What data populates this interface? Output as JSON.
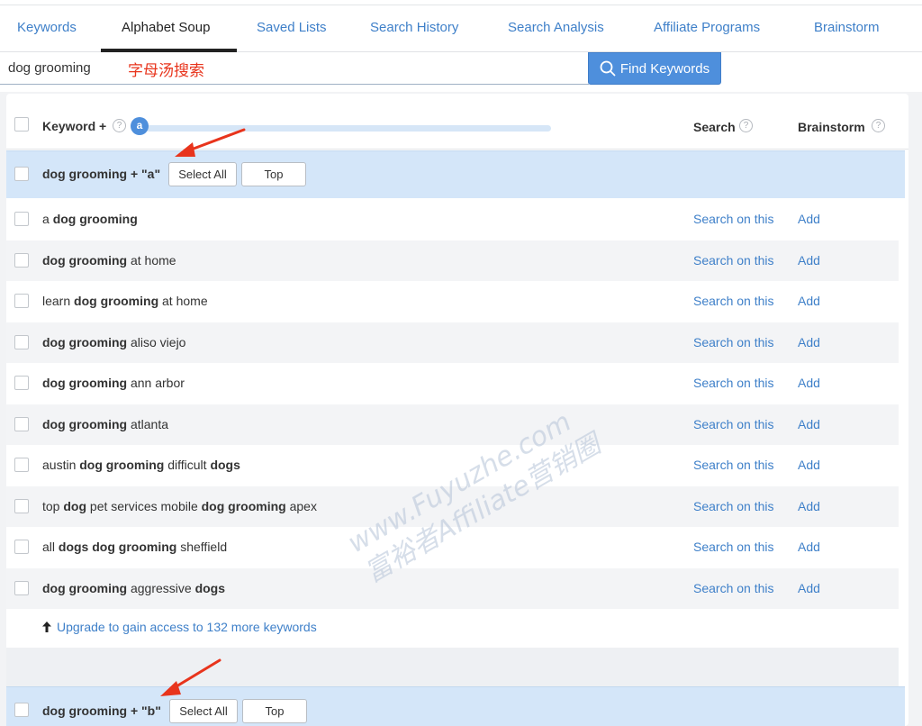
{
  "nav": {
    "tabs": [
      {
        "label": "Keywords"
      },
      {
        "label": "Alphabet Soup"
      },
      {
        "label": "Saved Lists"
      },
      {
        "label": "Search History"
      },
      {
        "label": "Search Analysis"
      },
      {
        "label": "Affiliate Programs"
      },
      {
        "label": "Brainstorm"
      }
    ],
    "active_tab": "Alphabet Soup"
  },
  "search": {
    "value": "dog grooming",
    "annotation": "字母汤搜索",
    "button_label": "Find Keywords",
    "button_icon": "search-icon"
  },
  "table": {
    "header": {
      "keyword_label": "Keyword +",
      "slider_letter": "a",
      "search_label": "Search",
      "brainstorm_label": "Brainstorm",
      "help_icon": "?"
    },
    "groups": [
      {
        "label": "dog grooming + \"a\"",
        "select_all": "Select All",
        "top": "Top"
      },
      {
        "label": "dog grooming + \"b\"",
        "select_all": "Select All",
        "top": "Top"
      }
    ],
    "rows": [
      {
        "pre": "a ",
        "b1": "dog grooming",
        "mid": "",
        "b2": "",
        "post": "",
        "search": "Search on this",
        "add": "Add"
      },
      {
        "pre": "",
        "b1": "dog grooming",
        "mid": " at home",
        "b2": "",
        "post": "",
        "search": "Search on this",
        "add": "Add"
      },
      {
        "pre": "learn ",
        "b1": "dog grooming",
        "mid": " at home",
        "b2": "",
        "post": "",
        "search": "Search on this",
        "add": "Add"
      },
      {
        "pre": "",
        "b1": "dog grooming",
        "mid": " aliso viejo",
        "b2": "",
        "post": "",
        "search": "Search on this",
        "add": "Add"
      },
      {
        "pre": "",
        "b1": "dog grooming",
        "mid": " ann arbor",
        "b2": "",
        "post": "",
        "search": "Search on this",
        "add": "Add"
      },
      {
        "pre": "",
        "b1": "dog grooming",
        "mid": " atlanta",
        "b2": "",
        "post": "",
        "search": "Search on this",
        "add": "Add"
      },
      {
        "pre": "austin ",
        "b1": "dog grooming",
        "mid": " difficult ",
        "b2": "dogs",
        "post": "",
        "search": "Search on this",
        "add": "Add"
      },
      {
        "pre": "top ",
        "b1": "dog",
        "mid": " pet services mobile ",
        "b2": "dog grooming",
        "post": " apex",
        "search": "Search on this",
        "add": "Add"
      },
      {
        "pre": "all ",
        "b1": "dogs dog grooming",
        "mid": " sheffield",
        "b2": "",
        "post": "",
        "search": "Search on this",
        "add": "Add"
      },
      {
        "pre": "",
        "b1": "dog grooming",
        "mid": " aggressive ",
        "b2": "dogs",
        "post": "",
        "search": "Search on this",
        "add": "Add"
      }
    ],
    "upgrade_text": "Upgrade to gain access to 132 more keywords",
    "upgrade_icon": "arrow-up-icon"
  },
  "watermark": {
    "line1": "www.Fuyuzhe.com",
    "line2": "富裕者Affiliate营销圈"
  },
  "colors": {
    "accent": "#3f80c9",
    "button": "#4e8fdc",
    "group_bg": "#d4e6f9",
    "annotation": "#e8341c"
  }
}
